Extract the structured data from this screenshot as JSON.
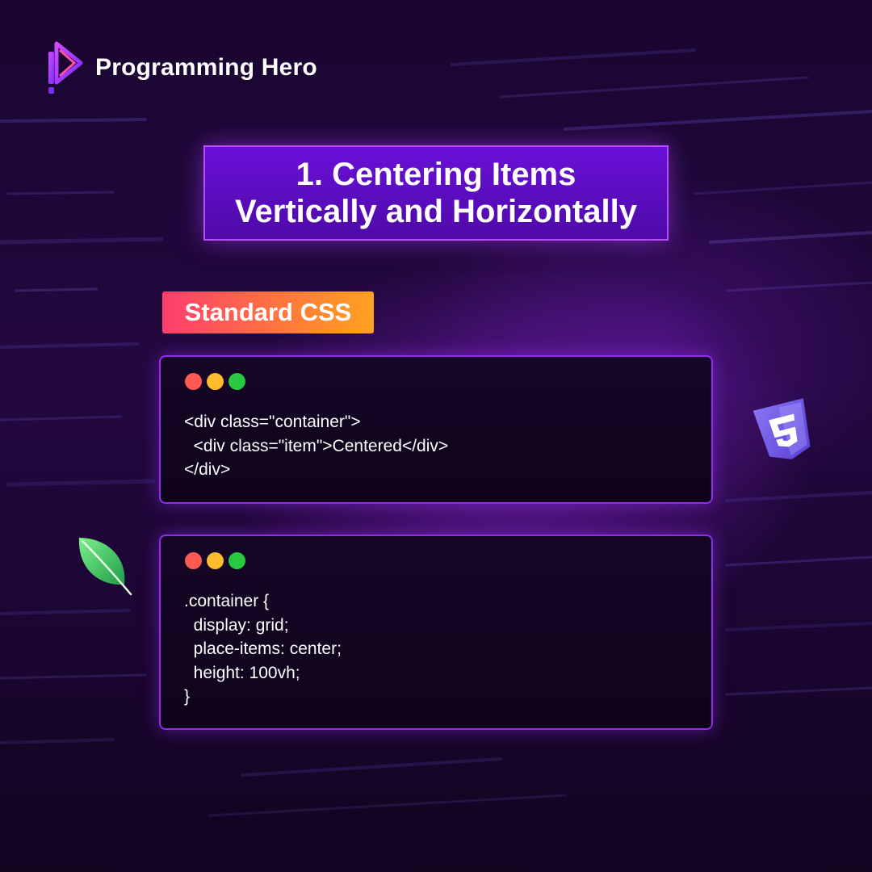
{
  "brand": {
    "name": "Programming Hero"
  },
  "title": {
    "lines": [
      "1. Centering Items",
      "Vertically and Horizontally"
    ]
  },
  "badge": {
    "label": "Standard CSS"
  },
  "html_snippet": {
    "lines": [
      "<div class=\"container\">",
      "  <div class=\"item\">Centered</div>",
      "</div>"
    ]
  },
  "css_snippet": {
    "lines": [
      ".container {",
      "  display: grid;",
      "  place-items: center;",
      "  height: 100vh;",
      "}"
    ]
  },
  "icons": {
    "brand_logo": "play-logo-icon",
    "css_logo": "css-shield-icon",
    "decor": "leaf-icon"
  },
  "colors": {
    "accent_purple": "#6a10d8",
    "border_purple": "#b54dff",
    "badge_start": "#ff3d6e",
    "badge_end": "#ffa21f",
    "dot_red": "#ff5a52",
    "dot_yellow": "#fdbb2d",
    "dot_green": "#28c840"
  }
}
